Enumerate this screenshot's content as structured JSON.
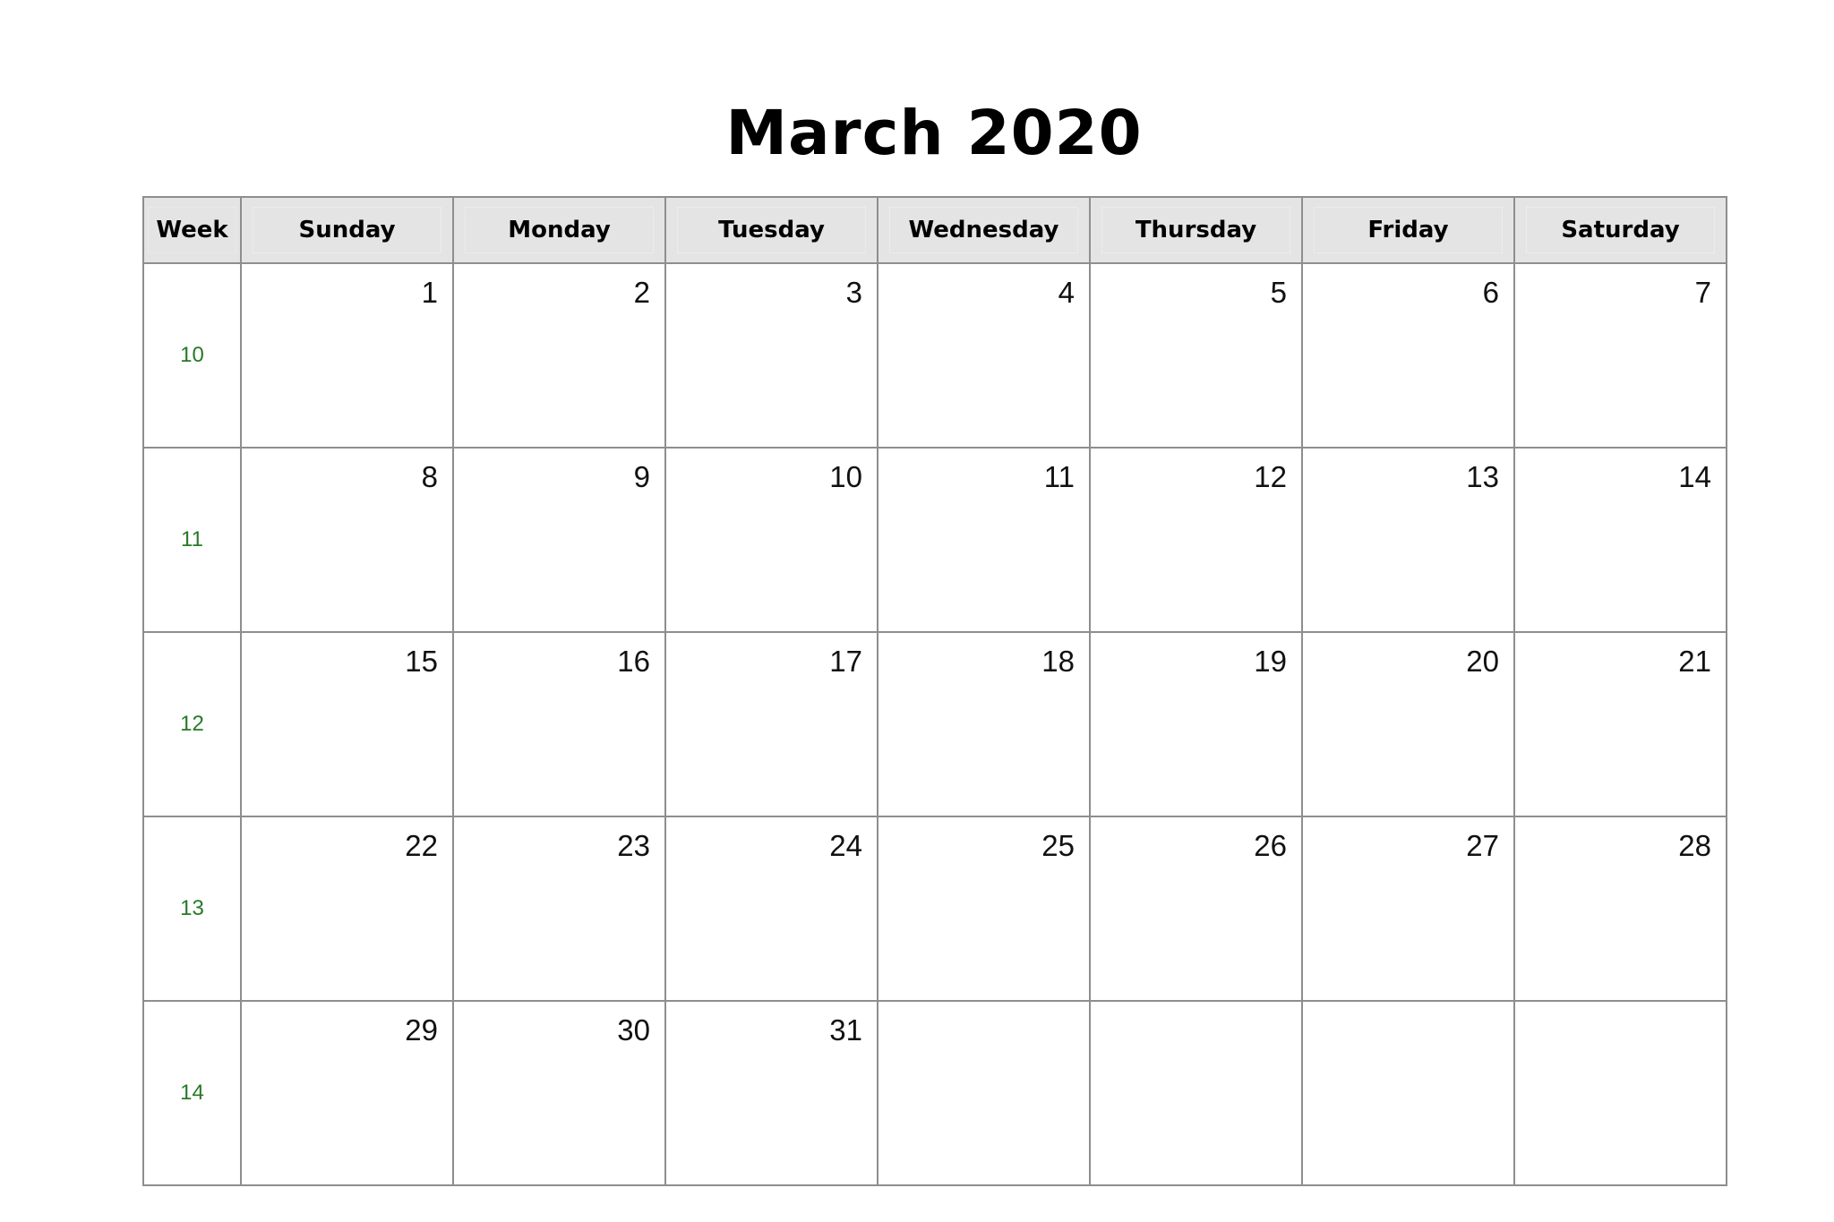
{
  "title": "March 2020",
  "header": {
    "week_label": "Week",
    "days": [
      "Sunday",
      "Monday",
      "Tuesday",
      "Wednesday",
      "Thursday",
      "Friday",
      "Saturday"
    ]
  },
  "colors": {
    "week_number": "#267a26",
    "header_bg": "#e4e4e4",
    "grid_line": "#8e8e8e"
  },
  "weeks": [
    {
      "week": "10",
      "days": [
        "1",
        "2",
        "3",
        "4",
        "5",
        "6",
        "7"
      ]
    },
    {
      "week": "11",
      "days": [
        "8",
        "9",
        "10",
        "11",
        "12",
        "13",
        "14"
      ]
    },
    {
      "week": "12",
      "days": [
        "15",
        "16",
        "17",
        "18",
        "19",
        "20",
        "21"
      ]
    },
    {
      "week": "13",
      "days": [
        "22",
        "23",
        "24",
        "25",
        "26",
        "27",
        "28"
      ]
    },
    {
      "week": "14",
      "days": [
        "29",
        "30",
        "31",
        "",
        "",
        "",
        ""
      ]
    }
  ]
}
